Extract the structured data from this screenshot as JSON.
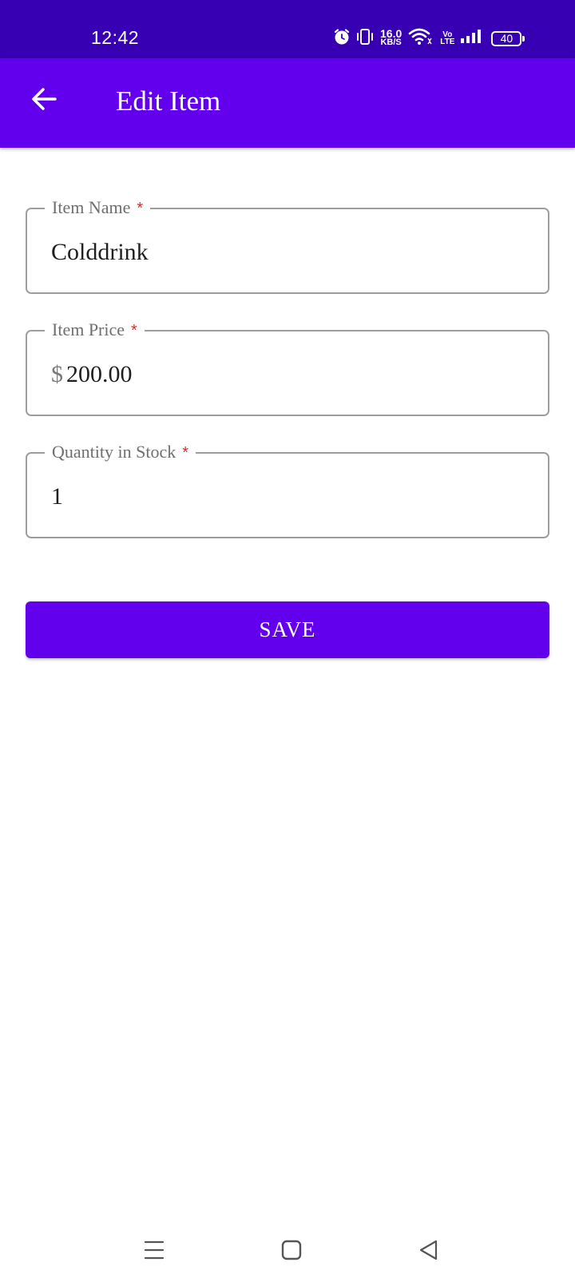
{
  "status_bar": {
    "time": "12:42",
    "net_speed_value": "16.0",
    "net_speed_unit": "KB/S",
    "volte_top": "Vo",
    "volte_bottom": "LTE",
    "battery": "40",
    "icons": [
      "alarm-icon",
      "vibrate-icon",
      "wifi-icon",
      "signal-icon",
      "battery-icon"
    ]
  },
  "app_bar": {
    "title": "Edit Item",
    "back_icon": "arrow-back-icon",
    "color": "#6200ee"
  },
  "form": {
    "fields": [
      {
        "label": "Item Name",
        "required_mark": "*",
        "value": "Colddrink"
      },
      {
        "label": "Item Price",
        "required_mark": "*",
        "prefix": "$",
        "value": "200.00"
      },
      {
        "label": "Quantity in Stock",
        "required_mark": "*",
        "value": "1"
      }
    ],
    "save_label": "SAVE"
  },
  "nav_bar": {
    "icons": [
      "recents-icon",
      "home-icon",
      "back-triangle-icon"
    ]
  },
  "colors": {
    "status_bar": "#3700b3",
    "primary": "#6200ee",
    "required": "#d32f2f"
  }
}
